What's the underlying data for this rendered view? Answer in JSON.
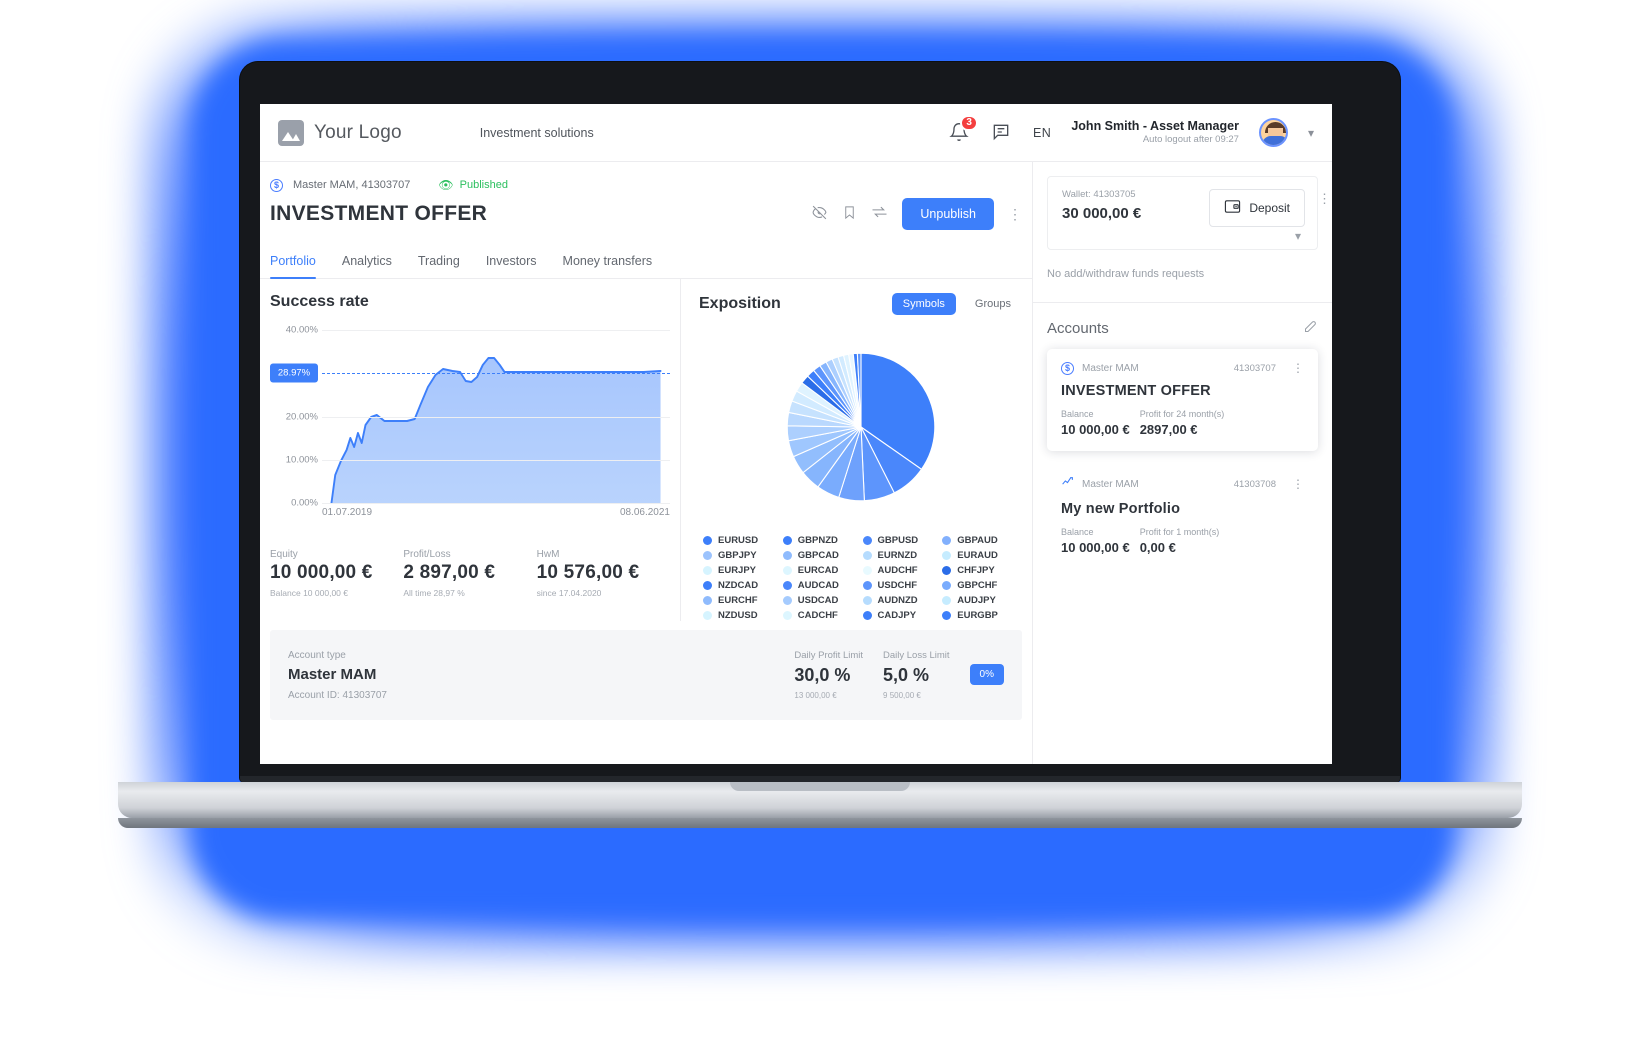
{
  "topbar": {
    "logo_text": "Your Logo",
    "nav_label": "Investment solutions",
    "notification_count": "3",
    "language": "EN",
    "user_name": "John Smith - Asset Manager",
    "user_sub": "Auto logout after 09:27"
  },
  "page": {
    "breadcrumb": "Master MAM, 41303707",
    "status": "Published",
    "title": "INVESTMENT OFFER",
    "primary_button": "Unpublish"
  },
  "tabs": [
    {
      "label": "Portfolio",
      "active": true
    },
    {
      "label": "Analytics",
      "active": false
    },
    {
      "label": "Trading",
      "active": false
    },
    {
      "label": "Investors",
      "active": false
    },
    {
      "label": "Money transfers",
      "active": false
    }
  ],
  "success": {
    "panel_title": "Success rate",
    "highlight": "28.97%",
    "date_from": "01.07.2019",
    "date_to": "08.06.2021",
    "stats": [
      {
        "label": "Equity",
        "value": "10 000,00 €",
        "sub": "Balance 10 000,00 €"
      },
      {
        "label": "Profit/Loss",
        "value": "2 897,00 €",
        "sub": "All time 28,97 %"
      },
      {
        "label": "HwM",
        "value": "10 576,00 €",
        "sub": "since 17.04.2020"
      }
    ]
  },
  "exposition": {
    "panel_title": "Exposition",
    "segments": [
      {
        "label": "Symbols",
        "active": true
      },
      {
        "label": "Groups",
        "active": false
      }
    ],
    "legend": [
      {
        "label": "EURUSD",
        "color": "#3d7ffa"
      },
      {
        "label": "GBPNZD",
        "color": "#3d7ffa"
      },
      {
        "label": "GBPUSD",
        "color": "#4a87fb"
      },
      {
        "label": "GBPAUD",
        "color": "#82b0fd"
      },
      {
        "label": "GBPJPY",
        "color": "#9cc3fd"
      },
      {
        "label": "GBPCAD",
        "color": "#8fbbfd"
      },
      {
        "label": "EURNZD",
        "color": "#b6dcfe"
      },
      {
        "label": "EURAUD",
        "color": "#c6ecff"
      },
      {
        "label": "EURJPY",
        "color": "#d6f4ff"
      },
      {
        "label": "EURCAD",
        "color": "#ddf6ff"
      },
      {
        "label": "AUDCHF",
        "color": "#e8faff"
      },
      {
        "label": "CHFJPY",
        "color": "#2b6de8"
      },
      {
        "label": "NZDCAD",
        "color": "#3d7ffa"
      },
      {
        "label": "AUDCAD",
        "color": "#4a87fb"
      },
      {
        "label": "USDCHF",
        "color": "#5d95fc"
      },
      {
        "label": "GBPCHF",
        "color": "#7aacfd"
      },
      {
        "label": "EURCHF",
        "color": "#8fbbfd"
      },
      {
        "label": "USDCAD",
        "color": "#a5cbfe"
      },
      {
        "label": "AUDNZD",
        "color": "#b6dcfe"
      },
      {
        "label": "AUDJPY",
        "color": "#c6ecff"
      },
      {
        "label": "NZDUSD",
        "color": "#d6f4ff"
      },
      {
        "label": "CADCHF",
        "color": "#ddf6ff"
      },
      {
        "label": "CADJPY",
        "color": "#3d7ffa"
      },
      {
        "label": "EURGBP",
        "color": "#3d7ffa"
      }
    ]
  },
  "limits": {
    "account_type_label": "Account type",
    "account_type_value": "Master MAM",
    "account_id": "Account ID: 41303707",
    "daily_profit_label": "Daily Profit Limit",
    "daily_profit_value": "30,0 %",
    "daily_profit_sub": "13 000,00 €",
    "daily_loss_label": "Daily Loss Limit",
    "daily_loss_value": "5,0 %",
    "daily_loss_sub": "9 500,00 €",
    "pct_pill": "0%"
  },
  "sidebar": {
    "wallet_label": "Wallet: 41303705",
    "wallet_value": "30 000,00 €",
    "deposit_button": "Deposit",
    "no_requests": "No add/withdraw funds requests",
    "accounts_title": "Accounts",
    "accounts": [
      {
        "type": "Master MAM",
        "id": "41303707",
        "name": "INVESTMENT OFFER",
        "balance_label": "Balance",
        "balance_value": "10 000,00 €",
        "profit_label": "Profit for 24 month(s)",
        "profit_value": "2897,00 €",
        "selected": true
      },
      {
        "type": "Master MAM",
        "id": "41303708",
        "name": "My new Portfolio",
        "balance_label": "Balance",
        "balance_value": "10 000,00 €",
        "profit_label": "Profit for 1 month(s)",
        "profit_value": "0,00 €",
        "selected": false
      }
    ]
  },
  "chart_data": {
    "type": "area",
    "title": "Success rate",
    "xlabel": "",
    "ylabel": "",
    "ylim": [
      0,
      40
    ],
    "y_ticks": [
      "0.00%",
      "10.00%",
      "20.00%",
      "40.00%"
    ],
    "y_tick_values": [
      0,
      10,
      20,
      40
    ],
    "grid": true,
    "highlight_value": 28.97,
    "highlight_label": "28.97%",
    "x_range": [
      "01.07.2019",
      "08.06.2021"
    ],
    "series": [
      {
        "name": "Success rate",
        "color": "#3d7ffa",
        "x": [
          0,
          2,
          4,
          6,
          8,
          10,
          12,
          14,
          16,
          18,
          20,
          22,
          24,
          26,
          28,
          30,
          33,
          36,
          39,
          42,
          45,
          48,
          52,
          56,
          60,
          65,
          70,
          75,
          80,
          85,
          90,
          95,
          100
        ],
        "values": [
          0,
          6.5,
          9.5,
          8.5,
          10.5,
          9.0,
          13.5,
          15.5,
          14.8,
          14.5,
          14.5,
          14.5,
          14.6,
          18.0,
          22.5,
          26.5,
          28.8,
          29.0,
          27.3,
          28.0,
          31.5,
          33.2,
          29.4,
          29.0,
          29.0,
          29.0,
          29.0,
          29.0,
          29.0,
          29.0,
          29.0,
          29.0,
          28.97
        ]
      }
    ]
  },
  "pie_data": {
    "type": "pie",
    "title": "Exposition",
    "slices": [
      {
        "label": "EURUSD",
        "value": 31.0,
        "color": "#3d7ffa"
      },
      {
        "label": "GBPJPY",
        "value": 7.0,
        "color": "#4a87fb"
      },
      {
        "label": "EURJPY",
        "value": 6.0,
        "color": "#5d95fc"
      },
      {
        "label": "NZDCAD",
        "value": 5.0,
        "color": "#6ea1fc"
      },
      {
        "label": "EURCHF",
        "value": 4.5,
        "color": "#7aacfd"
      },
      {
        "label": "NZDUSD",
        "value": 4.0,
        "color": "#86b5fd"
      },
      {
        "label": "GBPNZD",
        "value": 3.6,
        "color": "#92befd"
      },
      {
        "label": "GBPCAD",
        "value": 3.2,
        "color": "#9fc7fe"
      },
      {
        "label": "EURCAD",
        "value": 2.9,
        "color": "#accffe"
      },
      {
        "label": "AUDCAD",
        "value": 2.6,
        "color": "#b9d8fe"
      },
      {
        "label": "USDCAD",
        "value": 2.3,
        "color": "#c6e2fe"
      },
      {
        "label": "CADCHF",
        "value": 2.1,
        "color": "#d2ebff"
      },
      {
        "label": "GBPUSD",
        "value": 1.9,
        "color": "#dff3ff"
      },
      {
        "label": "EURNZD",
        "value": 1.7,
        "color": "#2b6de8"
      },
      {
        "label": "AUDCHF",
        "value": 1.6,
        "color": "#3d7ffa"
      },
      {
        "label": "USDCHF",
        "value": 1.5,
        "color": "#5d95fc"
      },
      {
        "label": "AUDNZD",
        "value": 1.4,
        "color": "#86b5fd"
      },
      {
        "label": "CADJPY",
        "value": 1.3,
        "color": "#accffe"
      },
      {
        "label": "GBPAUD",
        "value": 1.2,
        "color": "#c6e2fe"
      },
      {
        "label": "EURAUD",
        "value": 1.1,
        "color": "#d2ebff"
      },
      {
        "label": "CHFJPY",
        "value": 1.0,
        "color": "#dff3ff"
      },
      {
        "label": "GBPCHF",
        "value": 0.9,
        "color": "#eaf7ff"
      },
      {
        "label": "AUDJPY",
        "value": 0.8,
        "color": "#3d7ffa"
      },
      {
        "label": "EURGBP",
        "value": 0.7,
        "color": "#5d95fc"
      }
    ]
  }
}
